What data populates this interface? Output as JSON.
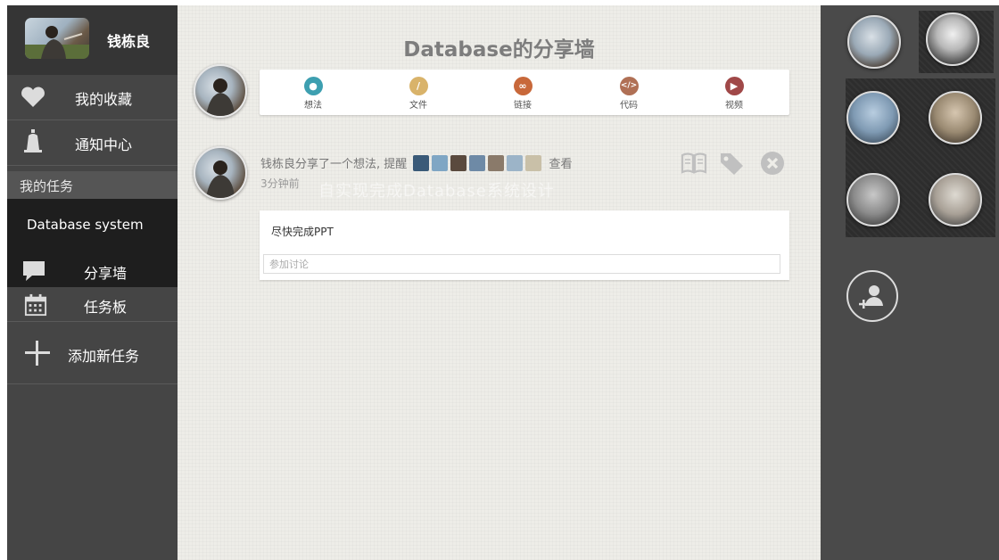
{
  "user": {
    "name": "钱栋良"
  },
  "sidebar": {
    "items": [
      {
        "label": "我的收藏",
        "icon": "heart-icon"
      },
      {
        "label": "通知中心",
        "icon": "bell-icon"
      }
    ],
    "section_label": "我的任务",
    "tasks": [
      {
        "label": "Database system"
      }
    ],
    "task_subitems": [
      {
        "label": "分享墙",
        "icon": "speech-bubble-icon"
      },
      {
        "label": "任务板",
        "icon": "calendar-icon"
      }
    ],
    "add_task_label": "添加新任务"
  },
  "main": {
    "title": "Database的分享墙",
    "share_types": [
      {
        "label": "想法",
        "icon": "lightbulb-icon",
        "color": "#3d9fb0"
      },
      {
        "label": "文件",
        "icon": "paperclip-icon",
        "color": "#d9b36a"
      },
      {
        "label": "链接",
        "icon": "link-icon",
        "color": "#c8683a"
      },
      {
        "label": "代码",
        "icon": "code-icon",
        "color": "#b07055"
      },
      {
        "label": "视频",
        "icon": "video-icon",
        "color": "#a04848"
      }
    ],
    "post": {
      "meta_text": "钱栋良分享了一个想法, 提醒",
      "view_label": "查看",
      "time": "3分钟前",
      "ghost_text": "自实现完成Database系统设计",
      "content": "尽快完成PPT",
      "comment_placeholder": "参加讨论"
    }
  },
  "colors": {
    "sidebar_bg": "#454545",
    "active_task_bg": "#1e1e1e",
    "main_bg": "#eeede8",
    "right_bg": "#4a4a4a"
  }
}
